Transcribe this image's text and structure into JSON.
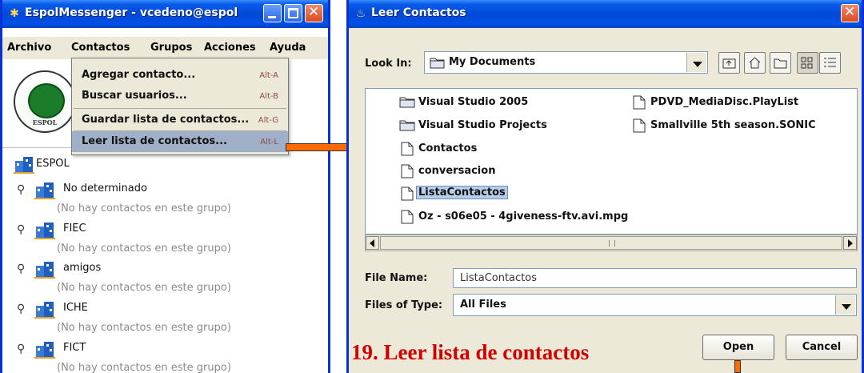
{
  "messenger": {
    "title": "EspolMessenger - vcedeno@espol",
    "menu": [
      "Archivo",
      "Contactos",
      "Grupos",
      "Acciones",
      "Ayuda"
    ],
    "logo_text": "ESPOL",
    "dropdown": [
      {
        "label": "Agregar contacto...",
        "accel": "Alt-A"
      },
      {
        "label": "Buscar usuarios...",
        "accel": "Alt-B"
      },
      {
        "label": "Guardar lista de contactos...",
        "accel": "Alt-G"
      },
      {
        "label": "Leer lista de contactos...",
        "accel": "Alt-L"
      }
    ],
    "root": "ESPOL",
    "groups": [
      {
        "name": "No determinado",
        "empty": "(No hay contactos en este grupo)"
      },
      {
        "name": "FIEC",
        "empty": "(No hay contactos en este grupo)"
      },
      {
        "name": "amigos",
        "empty": "(No hay contactos en este grupo)"
      },
      {
        "name": "ICHE",
        "empty": "(No hay contactos en este grupo)"
      },
      {
        "name": "FICT",
        "empty": "(No hay contactos en este grupo)"
      }
    ]
  },
  "dialog": {
    "title": "Leer Contactos",
    "look_in_label": "Look In:",
    "look_in_value": "My Documents",
    "files_col1": [
      {
        "name": "Visual Studio 2005",
        "type": "folder"
      },
      {
        "name": "Visual Studio Projects",
        "type": "folder"
      },
      {
        "name": "Contactos",
        "type": "file"
      },
      {
        "name": "conversacion",
        "type": "file"
      },
      {
        "name": "ListaContactos",
        "type": "file",
        "selected": true
      },
      {
        "name": "Oz - s06e05 - 4giveness-ftv.avi.mpg",
        "type": "file"
      }
    ],
    "files_col2": [
      {
        "name": "PDVD_MediaDisc.PlayList",
        "type": "file"
      },
      {
        "name": "Smallville 5th season.SONIC",
        "type": "file"
      }
    ],
    "file_name_label": "File Name:",
    "file_name_value": "ListaContactos",
    "files_of_type_label": "Files of Type:",
    "files_of_type_value": "All Files",
    "open_button": "Open",
    "cancel_button": "Cancel"
  },
  "caption": "19. Leer lista de contactos",
  "colors": {
    "xp_title_blue": "#0050e8",
    "arrow_orange": "#ff6a00",
    "caption_red": "#d40000"
  }
}
